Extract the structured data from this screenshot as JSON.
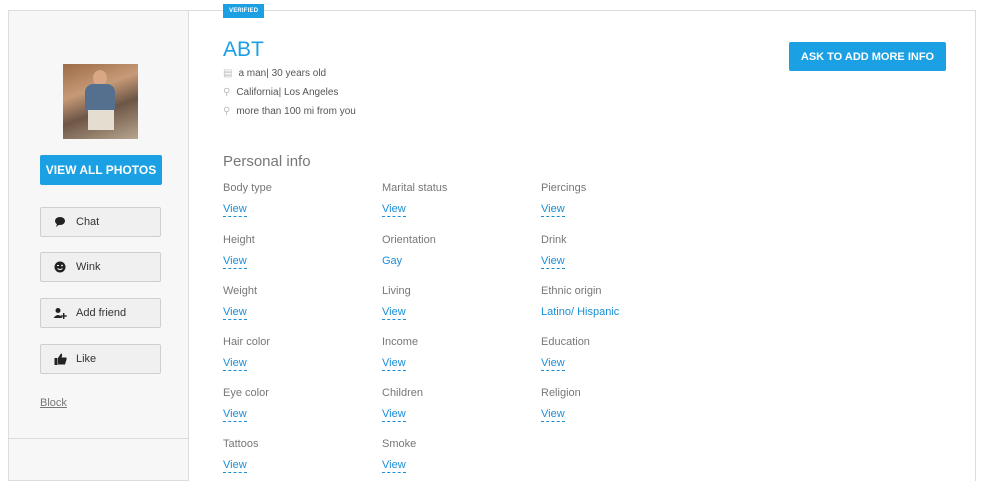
{
  "sidebar": {
    "view_photos_label": "VIEW ALL PHOTOS",
    "actions": [
      {
        "label": "Chat",
        "icon": "chat-bubble-icon"
      },
      {
        "label": "Wink",
        "icon": "wink-face-icon"
      },
      {
        "label": "Add friend",
        "icon": "add-friend-icon"
      },
      {
        "label": "Like",
        "icon": "thumbs-up-icon"
      }
    ],
    "block_label": "Block"
  },
  "profile": {
    "badge": "VERIFIED",
    "name": "ABT",
    "gender_age": "a man| 30 years old",
    "location": "California| Los Angeles",
    "distance": "more than 100 mi from you",
    "ask_button_label": "ASK TO ADD MORE INFO"
  },
  "personal_info": {
    "title": "Personal info",
    "fields": [
      {
        "label": "Body type",
        "value": "View"
      },
      {
        "label": "Marital status",
        "value": "View"
      },
      {
        "label": "Piercings",
        "value": "View"
      },
      {
        "label": "Height",
        "value": "View"
      },
      {
        "label": "Orientation",
        "value": "Gay"
      },
      {
        "label": "Drink",
        "value": "View"
      },
      {
        "label": "Weight",
        "value": "View"
      },
      {
        "label": "Living",
        "value": "View"
      },
      {
        "label": "Ethnic origin",
        "value": "Latino/ Hispanic"
      },
      {
        "label": "Hair color",
        "value": "View"
      },
      {
        "label": "Income",
        "value": "View"
      },
      {
        "label": "Education",
        "value": "View"
      },
      {
        "label": "Eye color",
        "value": "View"
      },
      {
        "label": "Children",
        "value": "View"
      },
      {
        "label": "Religion",
        "value": "View"
      },
      {
        "label": "Tattoos",
        "value": "View"
      },
      {
        "label": "Smoke",
        "value": "View"
      }
    ]
  },
  "colors": {
    "accent": "#1aa0e3",
    "link": "#1a8fd6",
    "sidebar_bg": "#f7f7f7"
  }
}
